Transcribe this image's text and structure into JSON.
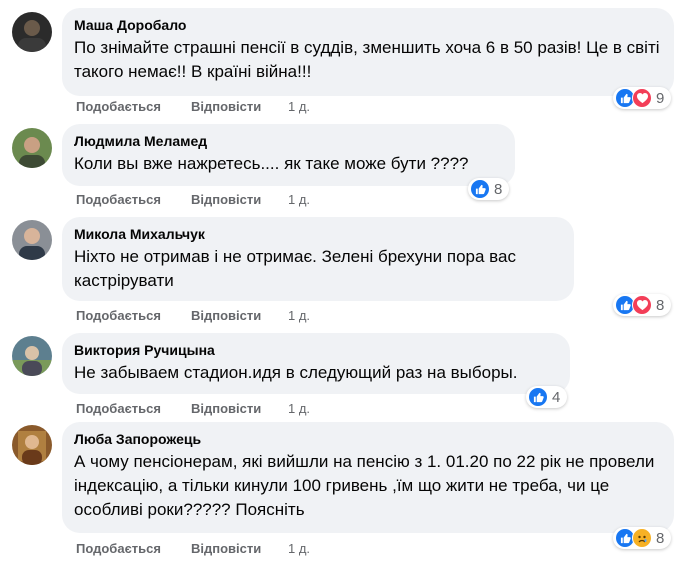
{
  "actions": {
    "like": "Подобається",
    "reply": "Відповісти"
  },
  "comments": [
    {
      "author": "Маша Доробало",
      "text": "По знімайте страшні пенсії в суддів, зменшить хоча 6 в 50 разів! Це в світі такого немає!! В країні війна!!!",
      "time": "1 д.",
      "reactions": [
        "like-icon",
        "love-icon"
      ],
      "reaction_count": "9",
      "avatar_color": "#2b2b2b"
    },
    {
      "author": "Людмила Меламед",
      "text": "Коли вы вже нажретесь.... як таке може бути ????",
      "time": "1 д.",
      "reactions": [
        "like-icon"
      ],
      "reaction_count": "8",
      "avatar_color": "#6b8a4f"
    },
    {
      "author": "Микола Михальчук",
      "text": "Ніхто не отримав і не отримає. Зелені брехуни пора вас кастрірувати",
      "time": "1 д.",
      "reactions": [
        "like-icon",
        "love-icon"
      ],
      "reaction_count": "8",
      "avatar_color": "#8a8f96"
    },
    {
      "author": "Виктория Ручицына",
      "text": "Не забываем стадион.идя в следующий раз на выборы.",
      "time": "1 д.",
      "reactions": [
        "like-icon"
      ],
      "reaction_count": "4",
      "avatar_color": "#5d7f8f"
    },
    {
      "author": "Люба Запорожець",
      "text": "А чому пенсіонерам, які вийшли на пенсію з 1. 01.20 по 22 рік не провели індексацію, а тільки кинули 100 гривень ,їм що жити не треба, чи це особливі роки????? Поясніть",
      "time": "1 д.",
      "reactions": [
        "like-icon",
        "sad-icon"
      ],
      "reaction_count": "8",
      "avatar_color": "#8a5a2b"
    }
  ]
}
